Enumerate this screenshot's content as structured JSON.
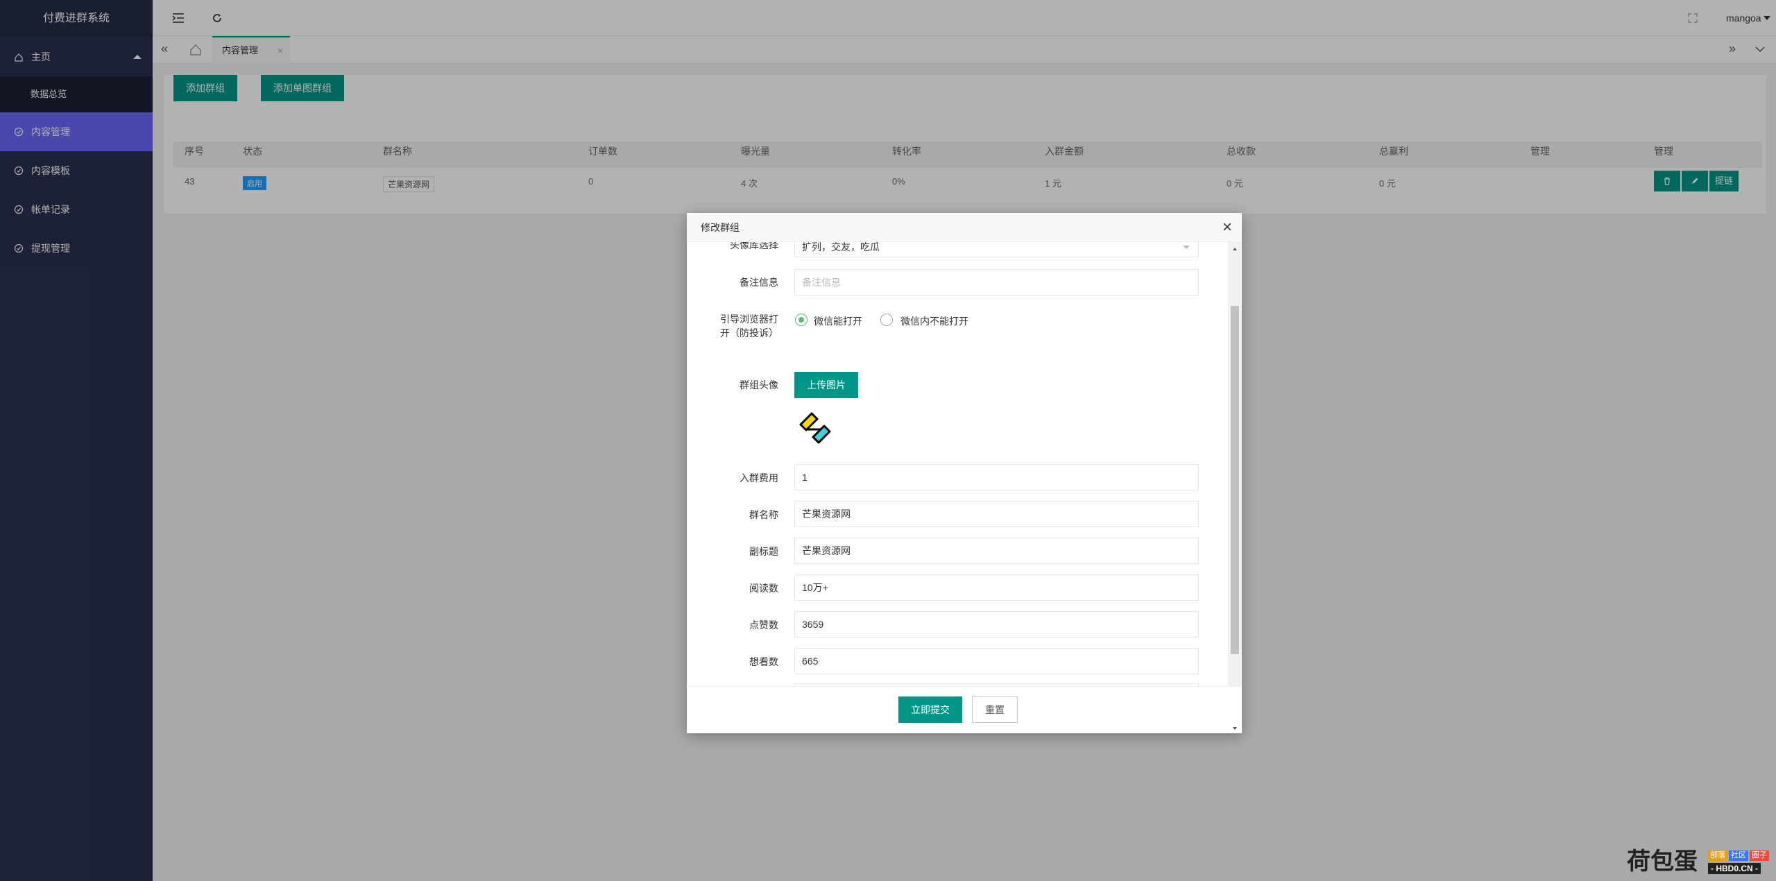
{
  "app_title": "付费进群系统",
  "sidebar": {
    "items": [
      {
        "label": "主页"
      },
      {
        "label": "数据总览"
      },
      {
        "label": "内容管理"
      },
      {
        "label": "内容模板"
      },
      {
        "label": "帐单记录"
      },
      {
        "label": "提现管理"
      }
    ]
  },
  "topbar": {
    "user": "mangoa"
  },
  "tabs": [
    {
      "label": "内容管理"
    }
  ],
  "toolbar": {
    "add_group": "添加群组",
    "add_single": "添加单图群组"
  },
  "table": {
    "headers": [
      "序号",
      "状态",
      "群名称",
      "订单数",
      "曝光量",
      "转化率",
      "入群金额",
      "总收款",
      "总赢利",
      "管理",
      "管理"
    ],
    "rows": [
      {
        "id": "43",
        "status": "启用",
        "name": "芒果资源网",
        "orders": "0",
        "exposure": "4 次",
        "rate": "0%",
        "fee": "1 元",
        "total": "0 元",
        "profit": "0 元",
        "op_link": "提链"
      }
    ]
  },
  "modal": {
    "title": "修改群组",
    "fields": {
      "avatar_lib_label": "头像库选择",
      "avatar_lib_value": "扩列，交友，吃瓜",
      "remark_label": "备注信息",
      "remark_placeholder": "备注信息",
      "guide_label": "引导浏览器打开（防投诉）",
      "guide_opt1": "微信能打开",
      "guide_opt2": "微信内不能打开",
      "avatar_label": "群组头像",
      "upload_label": "上传图片",
      "fee_label": "入群费用",
      "fee_value": "1",
      "name_label": "群名称",
      "name_value": "芒果资源网",
      "subtitle_label": "副标题",
      "subtitle_value": "芒果资源网",
      "reads_label": "阅读数",
      "reads_value": "10万+",
      "likes_label": "点赞数",
      "likes_value": "3659",
      "want_label": "想看数",
      "want_value": "665"
    },
    "submit": "立即提交",
    "reset": "重置"
  },
  "watermark": {
    "brand": "荷包蛋",
    "tag1": "部落",
    "tag2": "社区",
    "tag3": "圈子",
    "site": "- HBD0.CN -"
  },
  "colors": {
    "sidebar": "#2a3050",
    "active": "#6a68f6",
    "primary": "#009688",
    "badge": "#1e9fff"
  }
}
